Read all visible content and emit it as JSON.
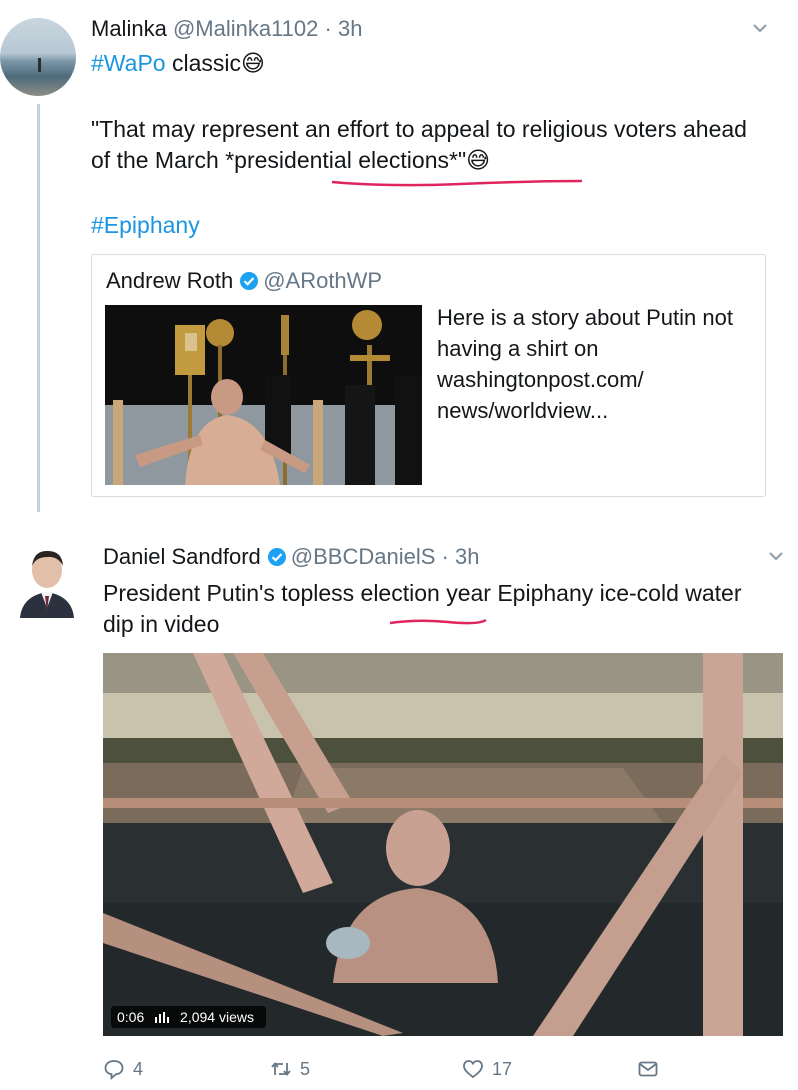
{
  "tweet1": {
    "author_name": "Malinka",
    "handle": "@Malinka1102",
    "time": "· 3h",
    "hashtag1": "#WaPo",
    "line1_rest": " classic",
    "emoji1": "😅",
    "quote_part1": "\"That may represent an effort to appeal to religious voters ahead of the March ",
    "quote_highlight": "*presidential elections*",
    "quote_part2": "\"",
    "emoji2": "😅",
    "hashtag2": "#Epiphany",
    "quoted_card": {
      "author_name": "Andrew Roth",
      "handle": "@ARothWP",
      "text": "Here is a story about Putin not having a shirt on washingtonpost.com/ news/worldview..."
    }
  },
  "tweet2": {
    "author_name": "Daniel Sandford",
    "handle": "@BBCDanielS",
    "time": "· 3h",
    "text": "President Putin's topless election year Epiphany ice-cold water dip in video",
    "video": {
      "duration": "0:06",
      "views": "2,094 views"
    },
    "actions": {
      "reply_count": "4",
      "retweet_count": "5",
      "like_count": "17"
    }
  },
  "colors": {
    "link": "#1b95e0",
    "secondary_text": "#657786",
    "verified": "#1da1f2",
    "annotation_red": "#e0245e"
  },
  "icons": [
    "chevron-down-icon",
    "verified-badge-icon",
    "reply-icon",
    "retweet-icon",
    "like-icon",
    "direct-message-icon"
  ]
}
